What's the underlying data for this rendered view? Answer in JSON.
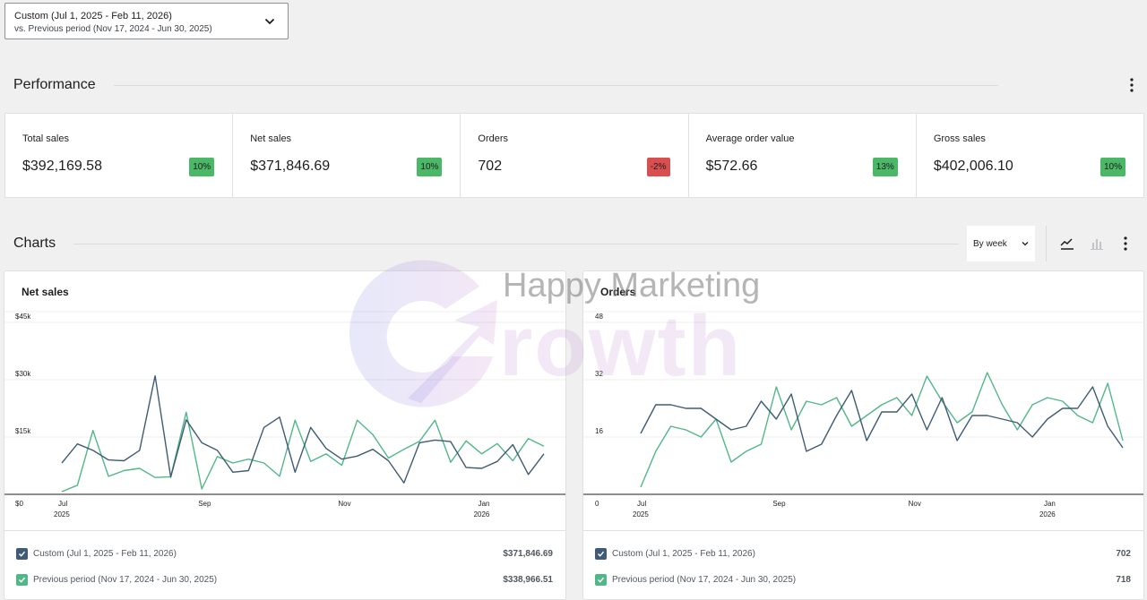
{
  "date_range": {
    "primary": "Custom (Jul 1, 2025 - Feb 11, 2026)",
    "comparison": "vs. Previous period (Nov 17, 2024 - Jun 30, 2025)"
  },
  "performance": {
    "title": "Performance",
    "cards": [
      {
        "label": "Total sales",
        "value": "$392,169.58",
        "delta": "10%",
        "trend": "up"
      },
      {
        "label": "Net sales",
        "value": "$371,846.69",
        "delta": "10%",
        "trend": "up"
      },
      {
        "label": "Orders",
        "value": "702",
        "delta": "-2%",
        "trend": "down"
      },
      {
        "label": "Average order value",
        "value": "$572.66",
        "delta": "13%",
        "trend": "up"
      },
      {
        "label": "Gross sales",
        "value": "$402,006.10",
        "delta": "10%",
        "trend": "up"
      }
    ]
  },
  "charts_section": {
    "title": "Charts",
    "interval": "By week"
  },
  "watermark": {
    "text": "Happy Marketing",
    "logo_word": "rowth"
  },
  "colors": {
    "current": "#3f5b75",
    "previous": "#52b788",
    "positive": "#4ab866",
    "negative": "#d94f4f"
  },
  "chart_data": [
    {
      "type": "line",
      "title": "Net sales",
      "ylim": [
        0,
        45000
      ],
      "y_ticks": [
        "$0",
        "$15k",
        "$30k",
        "$45k"
      ],
      "x_ticks": [
        {
          "label": "Jul",
          "sub": "2025",
          "index": 0
        },
        {
          "label": "Sep",
          "sub": "",
          "index": 9
        },
        {
          "label": "Nov",
          "sub": "",
          "index": 18
        },
        {
          "label": "Jan",
          "sub": "2026",
          "index": 27
        }
      ],
      "series": [
        {
          "name": "Custom (Jul 1, 2025 - Feb 11, 2026)",
          "total": "$371,846.69",
          "values": [
            8200,
            13200,
            11500,
            9000,
            8800,
            11500,
            31000,
            4500,
            19500,
            13500,
            11500,
            5800,
            6200,
            17500,
            20200,
            5800,
            17500,
            12000,
            9200,
            10000,
            11800,
            8800,
            3000,
            13500,
            14200,
            13800,
            7000,
            6800,
            8600,
            13000,
            5200,
            10600
          ]
        },
        {
          "name": "Previous period (Nov 17, 2024 - Jun 30, 2025)",
          "total": "$338,966.51",
          "values": [
            700,
            2400,
            16700,
            4700,
            6200,
            6800,
            4400,
            4600,
            21500,
            1400,
            9900,
            8200,
            9200,
            8200,
            4700,
            19400,
            8600,
            10600,
            7600,
            19400,
            15600,
            9500,
            11800,
            13900,
            19400,
            8400,
            14000,
            10600,
            13300,
            8800,
            14600,
            12600
          ]
        }
      ]
    },
    {
      "type": "line",
      "title": "Orders",
      "ylim": [
        0,
        48
      ],
      "y_ticks": [
        "0",
        "16",
        "32",
        "48"
      ],
      "x_ticks": [
        {
          "label": "Jul",
          "sub": "2025",
          "index": 0
        },
        {
          "label": "Sep",
          "sub": "",
          "index": 9
        },
        {
          "label": "Nov",
          "sub": "",
          "index": 18
        },
        {
          "label": "Jan",
          "sub": "2026",
          "index": 27
        }
      ],
      "series": [
        {
          "name": "Custom (Jul 1, 2025 - Feb 11, 2026)",
          "total": "702",
          "values": [
            17,
            25,
            25,
            24,
            24,
            21,
            18,
            19,
            26,
            21,
            28,
            12,
            14,
            22,
            29,
            15,
            23,
            23,
            28,
            18,
            27,
            15,
            22,
            22,
            21,
            20,
            16,
            21,
            24,
            24,
            30,
            19,
            13
          ]
        },
        {
          "name": "Previous period (Nov 17, 2024 - Jun 30, 2025)",
          "total": "718",
          "values": [
            2,
            12,
            19,
            18,
            16,
            21,
            9,
            12,
            14,
            30,
            18,
            26,
            25,
            27,
            19,
            22,
            25,
            27,
            22,
            33,
            26,
            20,
            23,
            34,
            25,
            18,
            25,
            27,
            26,
            22,
            20,
            31,
            15
          ]
        }
      ]
    }
  ]
}
